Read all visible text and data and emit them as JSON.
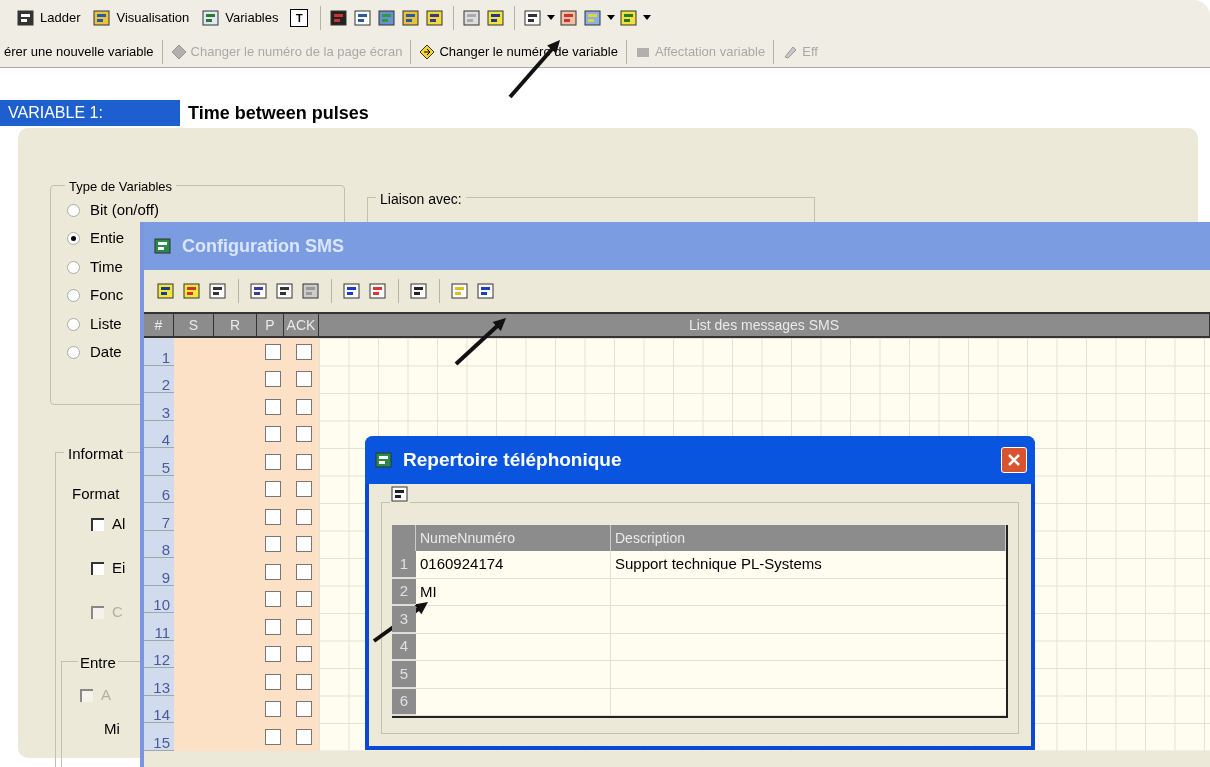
{
  "toolbar": [
    {
      "kind": "text",
      "label": "Ladder"
    },
    {
      "kind": "text",
      "label": "Visualisation"
    },
    {
      "kind": "text",
      "label": "Variables"
    },
    {
      "kind": "glyph",
      "label": "T"
    }
  ],
  "action_bar": [
    {
      "label": "érer une nouvelle variable",
      "disabled": false
    },
    {
      "label": "Changer le numéro de la page écran",
      "disabled": true
    },
    {
      "label": "Changer le numéro de variable",
      "disabled": false
    },
    {
      "label": "Affectation variable",
      "disabled": true
    },
    {
      "label": "Eff",
      "disabled": true
    }
  ],
  "variable": {
    "label": "VARIABLE 1:",
    "name": "Time between pulses"
  },
  "form": {
    "type_group": {
      "title": "Type de Variables",
      "options": [
        {
          "label": "Bit (on/off)",
          "selected": false
        },
        {
          "label": "Entie",
          "selected": true
        },
        {
          "label": "Time",
          "selected": false
        },
        {
          "label": "Fonc",
          "selected": false
        },
        {
          "label": "Liste",
          "selected": false
        },
        {
          "label": "Date",
          "selected": false
        }
      ]
    },
    "link_group": {
      "title": "Liaison avec:"
    },
    "info_group": {
      "title": "Informat",
      "format_label": "Format",
      "checkboxes": [
        {
          "label": "Al",
          "checked": false,
          "disabled": false
        },
        {
          "label": "Ei",
          "checked": false,
          "disabled": false
        },
        {
          "label": "C",
          "checked": false,
          "disabled": true
        }
      ],
      "entry_group": {
        "title": "Entre",
        "checkbox": {
          "label": "A",
          "checked": false,
          "disabled": true
        },
        "min_label": "Mi"
      }
    }
  },
  "sms_window": {
    "title": "Configuration SMS",
    "columns": [
      "#",
      "S",
      "R",
      "P",
      "ACK",
      "List des messages SMS"
    ],
    "rows": [
      {
        "num": "1",
        "p": false,
        "ack": false
      },
      {
        "num": "2",
        "p": false,
        "ack": false
      },
      {
        "num": "3",
        "p": false,
        "ack": false
      },
      {
        "num": "4",
        "p": false,
        "ack": false
      },
      {
        "num": "5",
        "p": false,
        "ack": false
      },
      {
        "num": "6",
        "p": false,
        "ack": false
      },
      {
        "num": "7",
        "p": false,
        "ack": false
      },
      {
        "num": "8",
        "p": false,
        "ack": false
      },
      {
        "num": "9",
        "p": false,
        "ack": false
      },
      {
        "num": "10",
        "p": false,
        "ack": false
      },
      {
        "num": "11",
        "p": false,
        "ack": false
      },
      {
        "num": "12",
        "p": false,
        "ack": false
      },
      {
        "num": "13",
        "p": false,
        "ack": false
      },
      {
        "num": "14",
        "p": false,
        "ack": false
      },
      {
        "num": "15",
        "p": false,
        "ack": false
      }
    ]
  },
  "phonebook": {
    "title": "Repertoire téléphonique",
    "columns": [
      "NumeNnuméro",
      "Description"
    ],
    "rows": [
      {
        "num": "1",
        "number": "0160924174",
        "description": "Support technique PL-Systems"
      },
      {
        "num": "2",
        "number": "MI"
      },
      {
        "num": "3"
      },
      {
        "num": "4"
      },
      {
        "num": "5"
      },
      {
        "num": "6"
      }
    ]
  }
}
